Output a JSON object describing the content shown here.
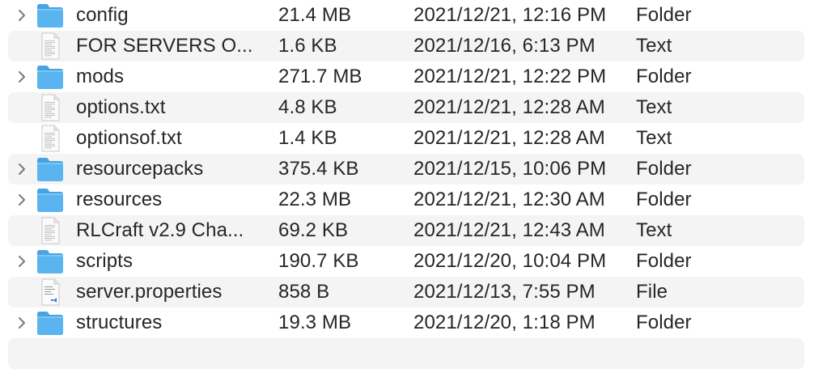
{
  "files": [
    {
      "name": "config",
      "size": "21.4 MB",
      "date": "2021/12/21, 12:16 PM",
      "kind": "Folder",
      "icon": "folder-icon",
      "expandable": true
    },
    {
      "name": "FOR SERVERS O...",
      "size": "1.6 KB",
      "date": "2021/12/16, 6:13 PM",
      "kind": "Text",
      "icon": "text-document-icon",
      "expandable": false
    },
    {
      "name": "mods",
      "size": "271.7 MB",
      "date": "2021/12/21, 12:22 PM",
      "kind": "Folder",
      "icon": "folder-icon",
      "expandable": true
    },
    {
      "name": "options.txt",
      "size": "4.8 KB",
      "date": "2021/12/21, 12:28 AM",
      "kind": "Text",
      "icon": "text-document-icon",
      "expandable": false
    },
    {
      "name": "optionsof.txt",
      "size": "1.4 KB",
      "date": "2021/12/21, 12:28 AM",
      "kind": "Text",
      "icon": "text-document-icon",
      "expandable": false
    },
    {
      "name": "resourcepacks",
      "size": "375.4 KB",
      "date": "2021/12/15, 10:06 PM",
      "kind": "Folder",
      "icon": "folder-icon",
      "expandable": true
    },
    {
      "name": "resources",
      "size": "22.3 MB",
      "date": "2021/12/21, 12:30 AM",
      "kind": "Folder",
      "icon": "folder-icon",
      "expandable": true
    },
    {
      "name": "RLCraft v2.9 Cha...",
      "size": "69.2 KB",
      "date": "2021/12/21, 12:43 AM",
      "kind": "Text",
      "icon": "text-document-icon",
      "expandable": false
    },
    {
      "name": "scripts",
      "size": "190.7 KB",
      "date": "2021/12/20, 10:04 PM",
      "kind": "Folder",
      "icon": "folder-icon",
      "expandable": true
    },
    {
      "name": "server.properties",
      "size": "858 B",
      "date": "2021/12/13, 7:55 PM",
      "kind": "File",
      "icon": "properties-file-icon",
      "expandable": false
    },
    {
      "name": "structures",
      "size": "19.3 MB",
      "date": "2021/12/20, 1:18 PM",
      "kind": "Folder",
      "icon": "folder-icon",
      "expandable": true
    }
  ],
  "colors": {
    "folder_body": "#5ab4ef",
    "folder_tab": "#49a3e3",
    "row_stripe": "#f4f4f4",
    "text": "#262626",
    "chevron": "#7a7a7a"
  }
}
